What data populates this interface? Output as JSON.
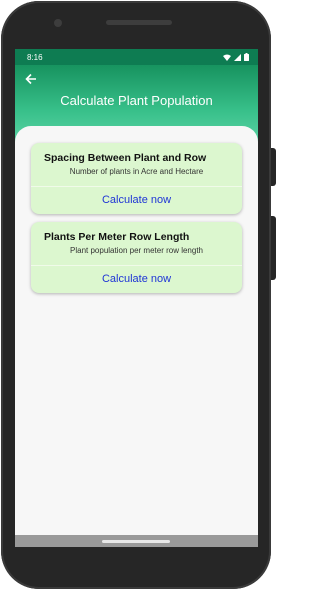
{
  "status_bar": {
    "time": "8:16",
    "icons": [
      "wifi-icon",
      "signal-icon",
      "battery-icon"
    ]
  },
  "toolbar": {
    "back_icon": "arrow-left-icon",
    "title": "Calculate Plant Population"
  },
  "cards": [
    {
      "title": "Spacing Between Plant and Row",
      "subtitle": "Number of plants in Acre and Hectare",
      "action": "Calculate now"
    },
    {
      "title": "Plants Per Meter Row Length",
      "subtitle": "Plant population per meter row length",
      "action": "Calculate now"
    }
  ],
  "colors": {
    "status_bar": "#0e7c52",
    "header_top": "#17935f",
    "header_bottom": "#6bdcb0",
    "card_bg": "#dcf7cf",
    "action_text": "#1f35d6"
  }
}
